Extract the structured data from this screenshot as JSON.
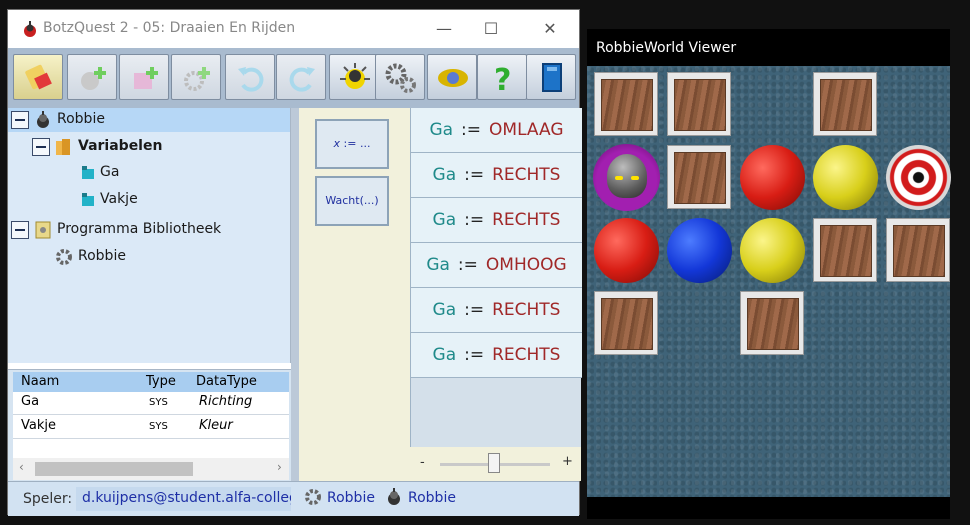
{
  "main_window": {
    "title": "BotzQuest 2 - 05: Draaien En Rijden",
    "controls": {
      "minimize": "—",
      "maximize": "☐",
      "close": "✕"
    },
    "toolbar_buttons": [
      "eraser-clear",
      "add-robot",
      "add-pink",
      "add-gear",
      "undo",
      "redo",
      "run",
      "settings",
      "badge",
      "help",
      "book"
    ],
    "tree": {
      "root": "Robbie",
      "variables_folder": "Variabelen",
      "variables": [
        "Ga",
        "Vakje"
      ],
      "library_folder": "Programma Bibliotheek",
      "library_items": [
        "Robbie"
      ]
    },
    "properties": {
      "headers": [
        "Naam",
        "Type",
        "DataType"
      ],
      "rows": [
        {
          "naam": "Ga",
          "type": "SYS",
          "datatype": "Richting"
        },
        {
          "naam": "Vakje",
          "type": "SYS",
          "datatype": "Kleur"
        }
      ],
      "scroll_left": "‹",
      "scroll_right": "›"
    },
    "palette": {
      "assign_var": "x",
      "assign_op": ":= ...",
      "wait": "Wacht(...)"
    },
    "program": [
      {
        "var": "Ga",
        "op": ":=",
        "value": "OMLAAG"
      },
      {
        "var": "Ga",
        "op": ":=",
        "value": "RECHTS"
      },
      {
        "var": "Ga",
        "op": ":=",
        "value": "RECHTS"
      },
      {
        "var": "Ga",
        "op": ":=",
        "value": "OMHOOG"
      },
      {
        "var": "Ga",
        "op": ":=",
        "value": "RECHTS"
      },
      {
        "var": "Ga",
        "op": ":=",
        "value": "RECHTS"
      }
    ],
    "zoom": {
      "minus": "-",
      "plus": "+",
      "level": 0.5
    },
    "status": {
      "label": "Speler:",
      "user": "d.kuijpens@student.alfa-college",
      "program": "Robbie",
      "robot": "Robbie"
    }
  },
  "viewer": {
    "title": "RobbieWorld Viewer",
    "grid": [
      [
        "crate",
        "crate",
        "",
        "crate",
        ""
      ],
      [
        "robot",
        "crate",
        "red",
        "yellow",
        "target"
      ],
      [
        "red",
        "blue",
        "yellow",
        "crate",
        "crate"
      ],
      [
        "crate",
        "",
        "crate",
        "",
        ""
      ]
    ]
  },
  "colors": {
    "accent_blue": "#1e2fa6",
    "variable_teal": "#1f8a8a",
    "value_red": "#a02828",
    "tree_bg": "#dbe9f7"
  }
}
